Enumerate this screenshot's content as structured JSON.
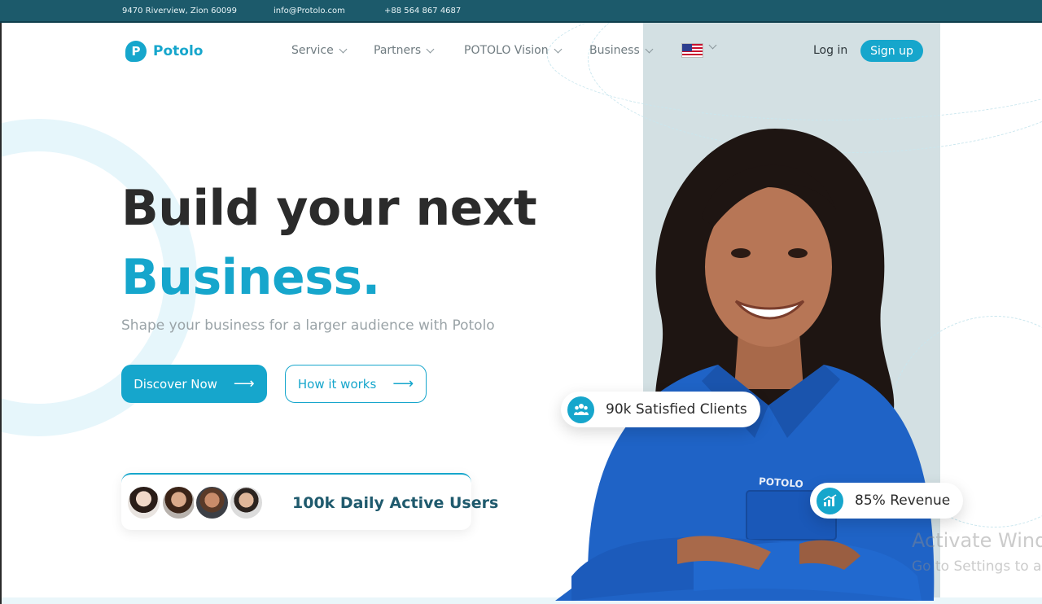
{
  "topbar": {
    "address": "9470 Riverview, Zion 60099",
    "email": "info@Protolo.com",
    "phone": "+88 564 867 4687"
  },
  "brand": {
    "logo_letter": "P",
    "name": "Potolo",
    "accent_color": "#16a6cc",
    "topbar_color": "#1c5a6b"
  },
  "nav": {
    "items": [
      {
        "label": "Service"
      },
      {
        "label": "Partners"
      },
      {
        "label": "POTOLO Vision"
      },
      {
        "label": "Business"
      }
    ],
    "language_icon": "us-flag-icon",
    "login_label": "Log in",
    "signup_label": "Sign up"
  },
  "hero": {
    "line1": "Build your next",
    "line2": "Business.",
    "subtitle": "Shape your business for a larger audience with Potolo",
    "primary_button": "Discover Now",
    "secondary_button": "How it works",
    "arrow": "⟶"
  },
  "users_card": {
    "text": "100k Daily Active Users",
    "avatars": [
      "avatar-woman-1",
      "avatar-woman-2",
      "avatar-man-1",
      "avatar-man-2"
    ]
  },
  "stats": {
    "clients_icon": "users-group-icon",
    "clients_text": "90k Satisfied Clients",
    "revenue_icon": "chart-growth-icon",
    "revenue_text": "85% Revenue"
  },
  "shirt_logo": "POTOLO",
  "os_watermark": {
    "line1": "Activate Windows",
    "line2": "Go to Settings to activate Windows."
  }
}
